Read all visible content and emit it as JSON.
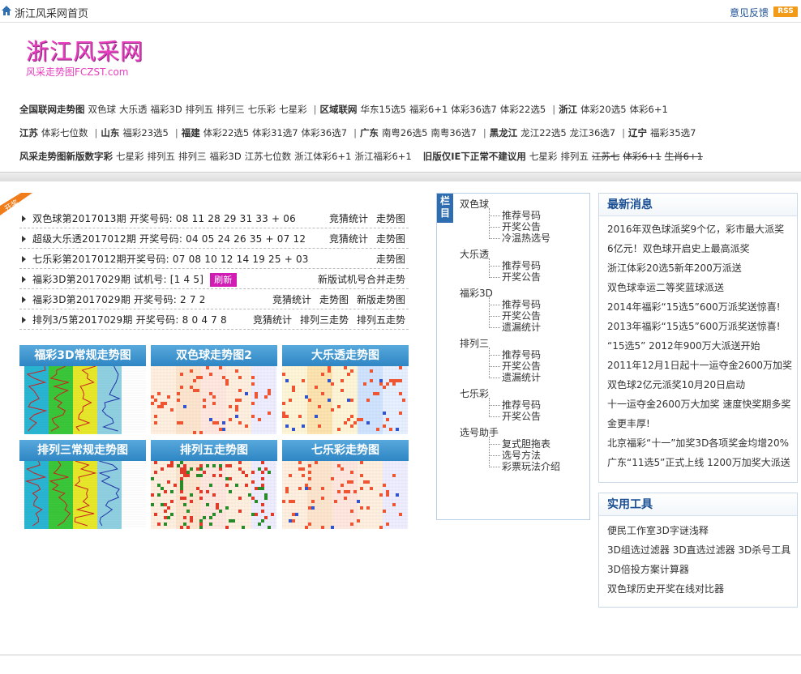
{
  "topbar": {
    "title": "浙江风采网首页",
    "feedback": "意见反馈",
    "rss": "RSS"
  },
  "logo": {
    "main": "浙江风采网",
    "sub": "风采走势图FCZST.com"
  },
  "nav": {
    "row1": [
      "全国联网走势图",
      "双色球",
      "大乐透",
      "福彩3D",
      "排列五",
      "排列三",
      "七乐彩",
      "七星彩",
      "|",
      "区域联网",
      "华东15选5",
      "福彩6+1",
      "体彩36选7",
      "体彩22选5",
      "|",
      "浙江",
      "体彩20选5",
      "体彩6+1"
    ],
    "row2": [
      "江苏",
      "体彩七位数",
      "|",
      "山东",
      "福彩23选5",
      "|",
      "福建",
      "体彩22选5",
      "体彩31选7",
      "体彩36选7",
      "|",
      "广东",
      "南粤26选5",
      "南粤36选7",
      "|",
      "黑龙江",
      "龙江22选5",
      "龙江36选7",
      "|",
      "辽宁",
      "福彩35选7"
    ],
    "row3": [
      "风采走势图新版数字彩",
      "七星彩",
      "排列五",
      "排列三",
      "福彩3D",
      "江苏七位数",
      "浙江体彩6+1",
      "浙江福彩6+1",
      "旧版仅IE下正常不建议用",
      "七星彩",
      "排列五",
      "江苏七",
      "体彩6+1",
      "生肖6+1"
    ]
  },
  "kaijiang_tag": "开奖",
  "results": [
    {
      "text": "双色球第2017013期 开奖号码: 08 11 28 29 31 33 + 06",
      "links": [
        "竞猜统计",
        "走势图"
      ]
    },
    {
      "text": "超级大乐透2017012期 开奖号码: 04 05 24 26 35 + 07 12",
      "links": [
        "竞猜统计",
        "走势图"
      ]
    },
    {
      "text": "七乐彩第2017012期开奖号码: 07 08 10 12 14 19 25 + 03",
      "links": [
        "走势图"
      ]
    },
    {
      "text": "福彩3D第2017029期  试机号: [1 4 5]",
      "refresh": "刷新",
      "links": [
        "新版试机号合并走势"
      ]
    },
    {
      "text": "福彩3D第2017029期 开奖号码:  2 7 2",
      "links": [
        "竞猜统计",
        "走势图",
        "新版走势图"
      ]
    },
    {
      "text": "排列3/5第2017029期 开奖号码: 8 0 4 7 8",
      "links": [
        "竞猜统计",
        "排列三走势",
        "排列五走势"
      ]
    }
  ],
  "thumbs": [
    {
      "caption": "福彩3D常规走势图",
      "style": "stripes"
    },
    {
      "caption": "双色球走势图2",
      "style": "dots"
    },
    {
      "caption": "大乐透走势图",
      "style": "dots2"
    },
    {
      "caption": "排列三常规走势图",
      "style": "stripes"
    },
    {
      "caption": "排列五走势图",
      "style": "dense"
    },
    {
      "caption": "七乐彩走势图",
      "style": "dots"
    }
  ],
  "sidebar": {
    "label": "栏目",
    "categories": [
      {
        "name": "双色球",
        "items": [
          "推荐号码",
          "开奖公告",
          "冷温热选号"
        ]
      },
      {
        "name": "大乐透",
        "items": [
          "推荐号码",
          "开奖公告"
        ]
      },
      {
        "name": "福彩3D",
        "items": [
          "推荐号码",
          "开奖公告",
          "遗漏统计"
        ]
      },
      {
        "name": "排列三",
        "items": [
          "推荐号码",
          "开奖公告",
          "遗漏统计"
        ]
      },
      {
        "name": "七乐彩",
        "items": [
          "推荐号码",
          "开奖公告"
        ]
      },
      {
        "name": "选号助手",
        "items": [
          "复式胆拖表",
          "选号方法",
          "彩票玩法介绍"
        ]
      }
    ]
  },
  "news": {
    "title": "最新消息",
    "items": [
      "2016年双色球派奖9个亿，彩市最大派奖",
      "6亿元！双色球开启史上最高派奖",
      "浙江体彩20选5新年200万派送",
      "双色球幸运二等奖蓝球派送",
      "2014年福彩“15选5”600万派奖送惊喜!",
      "2013年福彩“15选5”600万派奖送惊喜!",
      "“15选5” 2012年900万大派送开始",
      "2011年12月1日起十一运夺金2600万加奖",
      "双色球2亿元派奖10月20日启动",
      "十一运夺金2600万大加奖 速度快奖期多奖",
      "金更丰厚!",
      "北京福彩“十一”加奖3D各项奖金均增20%",
      "广东“11选5”正式上线 1200万加奖大派送"
    ]
  },
  "tools": {
    "title": "实用工具",
    "items": [
      "便民工作室3D字谜浅释",
      "3D组选过滤器 3D直选过滤器 3D杀号工具",
      "3D倍投方案计算器",
      "双色球历史开奖在线对比器"
    ]
  }
}
